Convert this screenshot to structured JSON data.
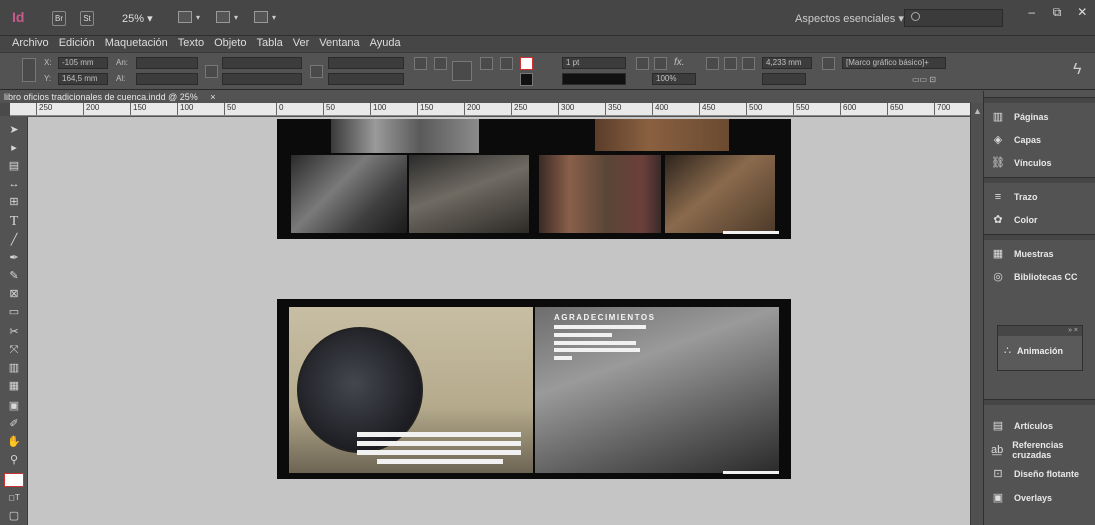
{
  "app": {
    "logo": "Id",
    "bridge": "Br",
    "stock": "St",
    "zoom": "25% ▾",
    "workspace": "Aspectos esenciales ▾",
    "search_placeholder": "",
    "win_min": "–",
    "win_max": "⧉",
    "win_close": "✕"
  },
  "menu": [
    "Archivo",
    "Edición",
    "Maquetación",
    "Texto",
    "Objeto",
    "Tabla",
    "Ver",
    "Ventana",
    "Ayuda"
  ],
  "control": {
    "x_label": "X:",
    "x_value": "-105 mm",
    "y_label": "Y:",
    "y_value": "164,5 mm",
    "w_label": "An:",
    "h_label": "Al:",
    "stroke_weight": "1 pt",
    "opacity": "100%",
    "spacing": "4,233 mm",
    "frame_style": "[Marco gráfico básico]+"
  },
  "document": {
    "tab_title": "libro oficios tradicionales de cuenca.indd @ 25%",
    "close": "×"
  },
  "ruler": {
    "ticks": [
      "250",
      "200",
      "150",
      "100",
      "50",
      "0",
      "50",
      "100",
      "150",
      "200",
      "250",
      "300",
      "350",
      "400",
      "450",
      "500",
      "550",
      "600",
      "650",
      "700"
    ]
  },
  "spread2": {
    "heading": "AGRADECIMIENTOS"
  },
  "panels": {
    "group1": [
      "Páginas",
      "Capas",
      "Vínculos"
    ],
    "group2": [
      "Trazo",
      "Color"
    ],
    "group3": [
      "Muestras",
      "Bibliotecas CC"
    ],
    "floating": "Animación",
    "group4": [
      "Artículos",
      "Referencias cruzadas",
      "Diseño flotante",
      "Overlays"
    ]
  }
}
